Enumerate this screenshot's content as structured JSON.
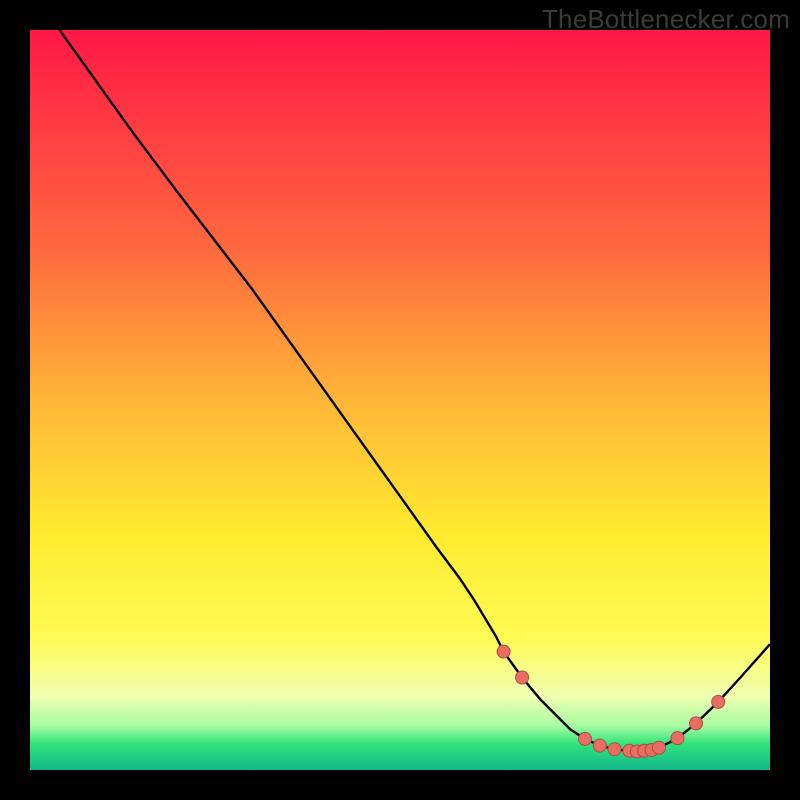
{
  "watermark": "TheBottlenecker.com",
  "chart_data": {
    "type": "line",
    "title": "",
    "xlabel": "",
    "ylabel": "",
    "xlim": [
      0,
      100
    ],
    "ylim": [
      0,
      100
    ],
    "series": [
      {
        "name": "curve",
        "x": [
          4,
          14,
          20,
          25,
          30,
          35,
          40,
          45,
          50,
          55,
          58,
          60,
          63,
          64,
          66.5,
          69,
          71,
          73,
          75,
          77,
          79,
          81,
          82,
          83,
          84,
          85,
          87.5,
          90,
          93,
          96,
          100
        ],
        "values": [
          100,
          86,
          78,
          71.5,
          65,
          58,
          51,
          44,
          37,
          30,
          26,
          23,
          18,
          16,
          12.5,
          9.5,
          7.5,
          5.5,
          4.2,
          3.3,
          2.8,
          2.6,
          2.5,
          2.6,
          2.7,
          3.0,
          4.3,
          6.3,
          9.2,
          12.5,
          17
        ]
      }
    ],
    "highlight_points": {
      "name": "dots",
      "x": [
        64,
        66.5,
        75,
        77,
        79,
        81,
        82,
        83,
        84,
        85,
        87.5,
        90,
        93
      ],
      "values": [
        16,
        12.5,
        4.2,
        3.3,
        2.8,
        2.6,
        2.5,
        2.6,
        2.7,
        3.0,
        4.3,
        6.3,
        9.2
      ]
    },
    "gradient_stops": [
      {
        "offset": 0.0,
        "color": "#ff1846"
      },
      {
        "offset": 0.3,
        "color": "#ff6a3e"
      },
      {
        "offset": 0.5,
        "color": "#ffb638"
      },
      {
        "offset": 0.68,
        "color": "#ffeb2f"
      },
      {
        "offset": 0.82,
        "color": "#fffc54"
      },
      {
        "offset": 0.9,
        "color": "#efffb0"
      },
      {
        "offset": 0.94,
        "color": "#a8fca2"
      },
      {
        "offset": 0.965,
        "color": "#2fe47a"
      },
      {
        "offset": 1.0,
        "color": "#12b78a"
      }
    ],
    "colors": {
      "line": "#000000",
      "dot_fill": "#e86e64",
      "dot_stroke": "#b04a42"
    }
  }
}
